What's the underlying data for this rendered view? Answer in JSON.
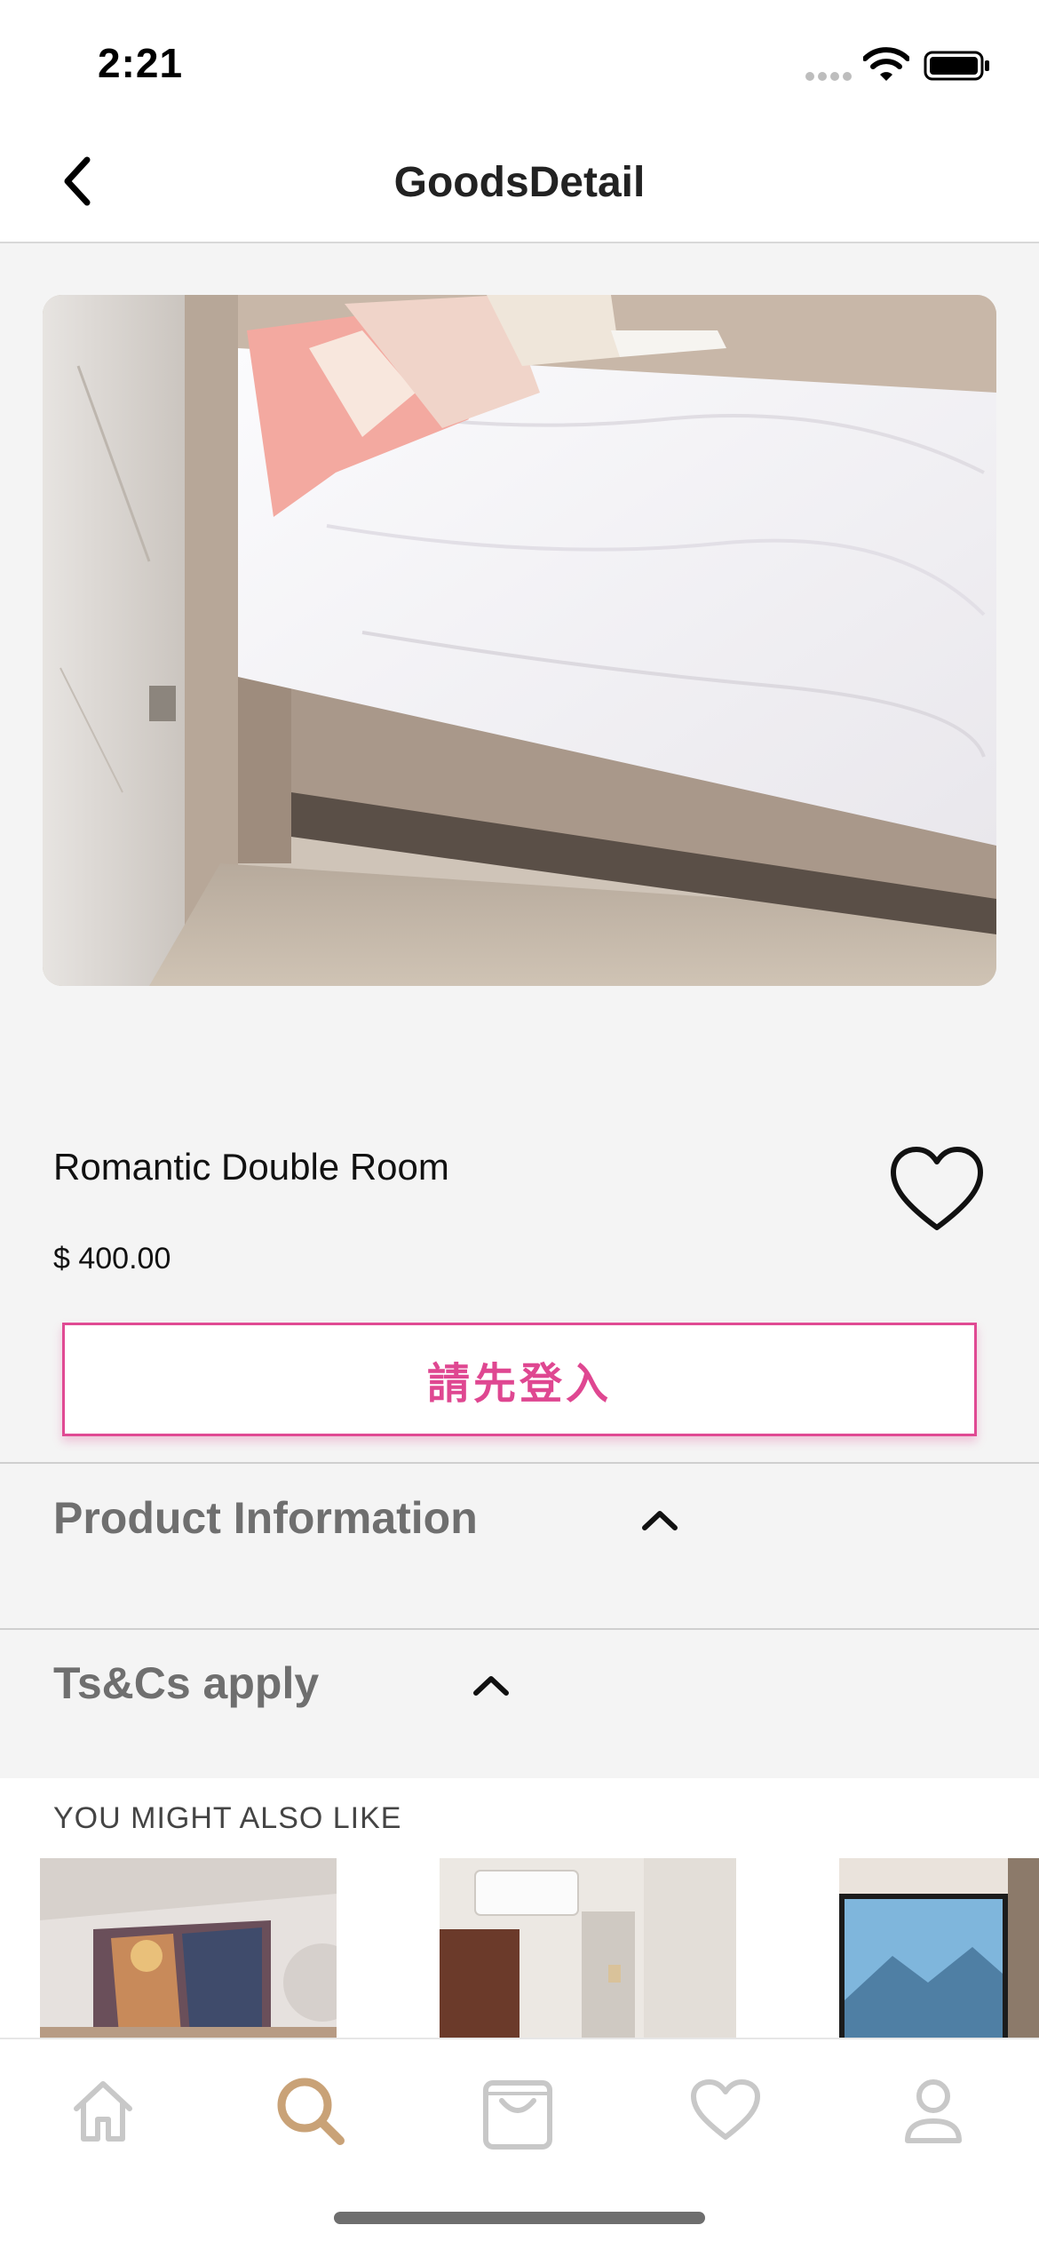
{
  "status_bar": {
    "time": "2:21"
  },
  "nav": {
    "title": "GoodsDetail",
    "back_icon": "chevron-left-icon"
  },
  "product": {
    "name": "Romantic Double Room",
    "price": "$ 400.00",
    "favorite_icon": "heart-outline-icon"
  },
  "actions": {
    "login_button_label": "請先登入"
  },
  "sections": [
    {
      "title": "Product Information",
      "expanded": false
    },
    {
      "title": "Ts&Cs apply",
      "expanded": false
    }
  ],
  "recommendations": {
    "title": "YOU MIGHT ALSO LIKE",
    "items": [
      {
        "image": "room-photo-graffiti-wall"
      },
      {
        "image": "room-photo-air-conditioner"
      },
      {
        "image": "room-photo-mountain-painting"
      }
    ]
  },
  "tab_bar": {
    "items": [
      {
        "icon": "home-icon",
        "active": false
      },
      {
        "icon": "search-icon",
        "active": true
      },
      {
        "icon": "shopping-bag-icon",
        "active": false
      },
      {
        "icon": "heart-icon",
        "active": false
      },
      {
        "icon": "profile-icon",
        "active": false
      }
    ]
  },
  "colors": {
    "accent_pink": "#df4791",
    "active_tab": "#c9a277",
    "inactive_tab": "#c8c8c8",
    "section_title": "#6f6f6f"
  }
}
